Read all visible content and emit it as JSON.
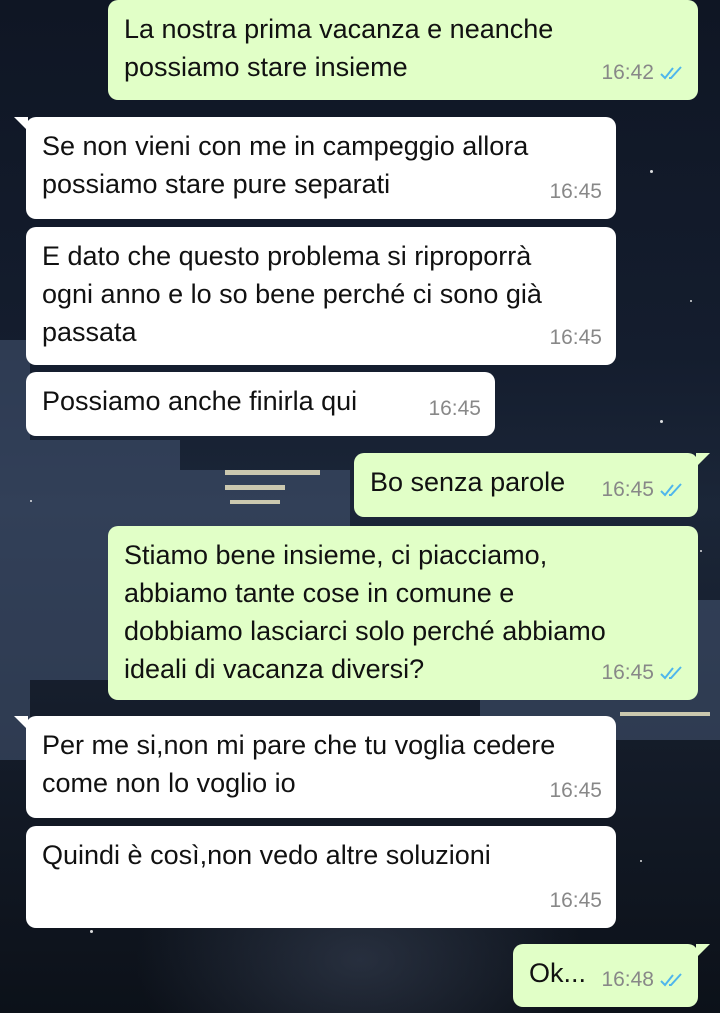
{
  "chat": {
    "messages": [
      {
        "direction": "out",
        "text": "La nostra prima vacanza e neanche\npossiamo stare insieme",
        "time": "16:42",
        "status": "read"
      },
      {
        "direction": "in",
        "text": "Se non vieni con me in campeggio allora\npossiamo stare pure separati",
        "time": "16:45"
      },
      {
        "direction": "in",
        "text": "E dato che questo problema si riproporrà\nogni anno e lo so bene perché ci sono già\npassata",
        "time": "16:45"
      },
      {
        "direction": "in",
        "text": "Possiamo anche finirla qui",
        "time": "16:45"
      },
      {
        "direction": "out",
        "text": "Bo senza parole",
        "time": "16:45",
        "status": "read"
      },
      {
        "direction": "out",
        "text": "Stiamo bene insieme, ci piacciamo,\nabbiamo tante cose in comune e\ndobbiamo lasciarci solo perché abbiamo\nideali di vacanza diversi?",
        "time": "16:45",
        "status": "read"
      },
      {
        "direction": "in",
        "text": "Per me si,non mi pare che tu voglia cedere\ncome non lo voglio io",
        "time": "16:45"
      },
      {
        "direction": "in",
        "text": "Quindi è così,non vedo altre soluzioni",
        "time": "16:45"
      },
      {
        "direction": "out",
        "text": "Ok...",
        "time": "16:48",
        "status": "read"
      }
    ]
  },
  "colors": {
    "incoming_bubble": "#ffffff",
    "outgoing_bubble": "#e1ffc7",
    "read_tick": "#4fb6ec",
    "timestamp": "#888888"
  },
  "icons": {
    "read_receipt": "double-check-icon"
  }
}
